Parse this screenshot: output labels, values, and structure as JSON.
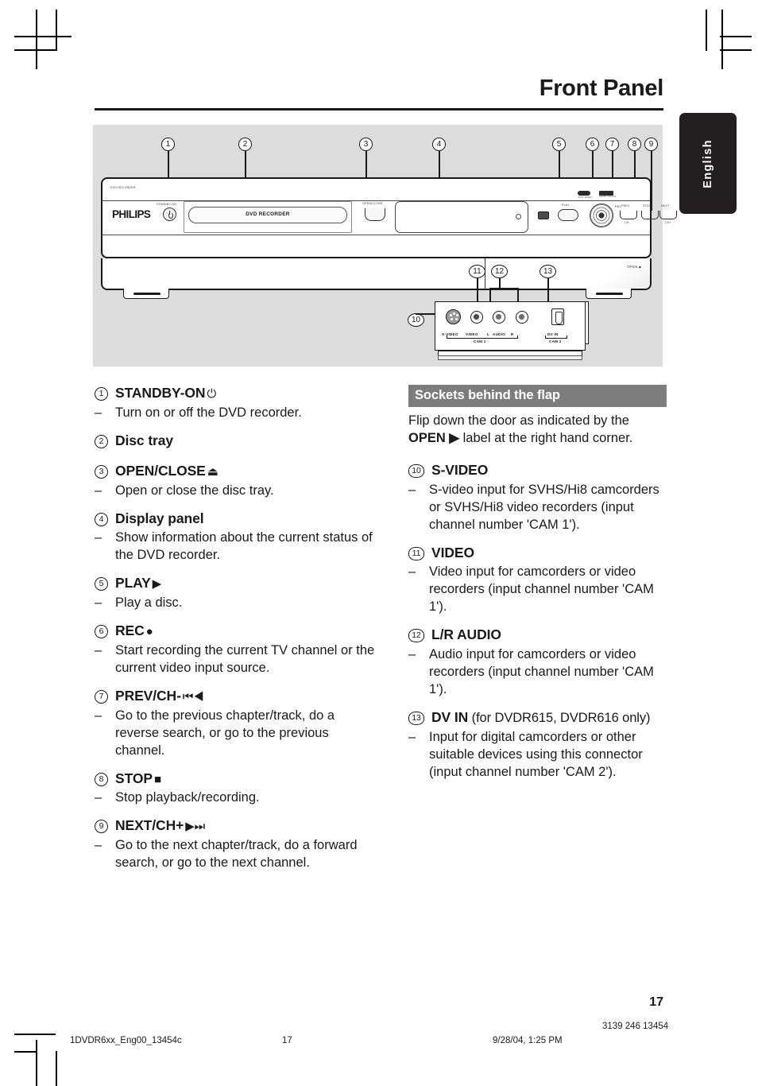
{
  "header": {
    "title": "Front Panel",
    "language_tab": "English"
  },
  "figure": {
    "device_brand": "PHILIPS",
    "device_type_label": "DVD RECORDER",
    "tray_label": "DVD RECORDER",
    "standby_label": "STANDBY-ON",
    "open_close_label": "OPEN/CLOSE",
    "play_label": "PLAY",
    "rec_label": "REC",
    "prev_label": "PREV",
    "stop_label": "STOP",
    "next_label": "NEXT",
    "ch_minus_label": "CH-",
    "ch_plus_label": "CH+",
    "open_flap_label": "OPEN ▶",
    "logo_dvd_video": "DVD VIDEO",
    "logo_dolby": "DOLBY DIGITAL",
    "callouts": [
      "1",
      "2",
      "3",
      "4",
      "5",
      "6",
      "7",
      "8",
      "9",
      "10",
      "11",
      "12",
      "13"
    ],
    "socket_labels": {
      "s_video": "S-VIDEO",
      "video": "VIDEO",
      "audio_l": "L",
      "audio": "AUDIO",
      "audio_r": "R",
      "cam1": "CAM 1",
      "dv_in": "DV IN",
      "cam2": "CAM 2"
    }
  },
  "left_column": [
    {
      "num": "1",
      "title": "STANDBY-ON",
      "glyph": "⏻",
      "desc": "Turn on or off the DVD recorder."
    },
    {
      "num": "2",
      "title": "Disc tray",
      "glyph": "",
      "desc": ""
    },
    {
      "num": "3",
      "title": "OPEN/CLOSE",
      "glyph": "⏏",
      "desc": "Open or close the disc tray."
    },
    {
      "num": "4",
      "title": "Display panel",
      "glyph": "",
      "desc": "Show information about the current status of the DVD recorder."
    },
    {
      "num": "5",
      "title": "PLAY",
      "glyph": "▶",
      "desc": "Play a disc."
    },
    {
      "num": "6",
      "title": "REC",
      "glyph": "●",
      "desc": "Start recording the current TV channel or the current video input source."
    },
    {
      "num": "7",
      "title": "PREV/CH-",
      "glyph": "⏮◀",
      "desc": "Go to the previous chapter/track, do a reverse search, or go to the previous channel."
    },
    {
      "num": "8",
      "title": "STOP",
      "glyph": "■",
      "desc": "Stop playback/recording."
    },
    {
      "num": "9",
      "title": "NEXT/CH+",
      "glyph": "▶⏭",
      "desc": "Go to the next chapter/track, do a forward search, or go to the next channel."
    }
  ],
  "right_column": {
    "section_title": "Sockets behind the flap",
    "intro_part1": "Flip down the door as indicated by the ",
    "intro_bold": "OPEN ▶",
    "intro_part2": " label at the right hand corner.",
    "items": [
      {
        "num": "10",
        "title": "S-VIDEO",
        "sub": "",
        "desc": "S-video input for SVHS/Hi8 camcorders or SVHS/Hi8 video recorders (input channel number 'CAM 1')."
      },
      {
        "num": "11",
        "title": "VIDEO",
        "sub": "",
        "desc": "Video input for camcorders or video recorders (input channel number 'CAM 1')."
      },
      {
        "num": "12",
        "title": "L/R AUDIO",
        "sub": "",
        "desc": "Audio input for camcorders or video recorders (input channel number 'CAM 1')."
      },
      {
        "num": "13",
        "title": "DV IN",
        "sub": " (for DVDR615, DVDR616 only)",
        "desc": "Input for digital camcorders or other suitable devices using this connector (input channel number 'CAM 2')."
      }
    ]
  },
  "page_number": "17",
  "footer": {
    "file_name": "1DVDR6xx_Eng00_13454c",
    "page": "17",
    "date": "9/28/04, 1:25 PM",
    "doc_code": "3139 246 13454"
  }
}
